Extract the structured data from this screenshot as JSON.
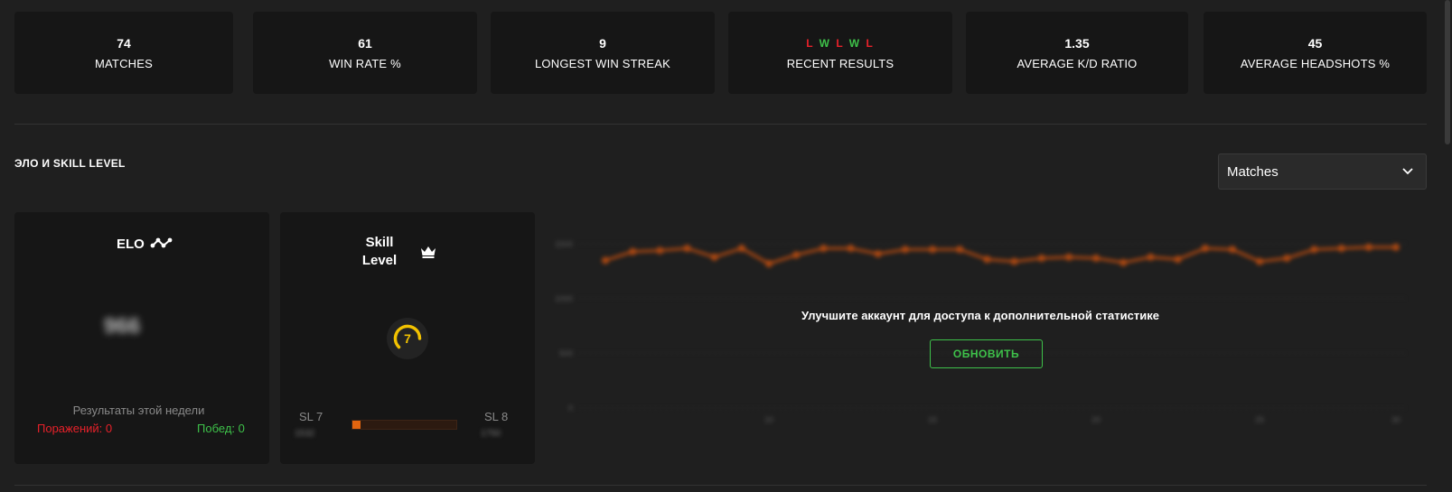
{
  "stats": [
    {
      "value": "74",
      "label": "MATCHES"
    },
    {
      "value": "61",
      "label": "WIN RATE %"
    },
    {
      "value": "9",
      "label": "LONGEST WIN STREAK"
    },
    {
      "value": "",
      "label": "RECENT RESULTS"
    },
    {
      "value": "1.35",
      "label": "AVERAGE K/D RATIO"
    },
    {
      "value": "45",
      "label": "AVERAGE HEADSHOTS %"
    }
  ],
  "recent_results": [
    "L",
    "W",
    "L",
    "W",
    "L"
  ],
  "section": {
    "title": "ЭЛО И SKILL LEVEL"
  },
  "select": {
    "value": "Matches"
  },
  "elo_card": {
    "title": "ELO",
    "value": "966",
    "week_title": "Результаты этой недели",
    "losses": "Поражений: 0",
    "wins": "Побед: 0"
  },
  "skill_card": {
    "title_line1": "Skill",
    "title_line2": "Level",
    "level": "7",
    "left_label": "SL 7",
    "right_label": "SL 8",
    "left_sub": "1532",
    "right_sub": "1750",
    "progress": 0.08
  },
  "chart_data": {
    "type": "line",
    "x": [
      1,
      2,
      3,
      4,
      5,
      6,
      7,
      8,
      9,
      10,
      11,
      12,
      13,
      14,
      15,
      16,
      17,
      18,
      19,
      20,
      21,
      22,
      23,
      24,
      25,
      26,
      27,
      28,
      29,
      30,
      31,
      32
    ],
    "y": [
      1350,
      1430,
      1440,
      1460,
      1380,
      1460,
      1320,
      1400,
      1460,
      1460,
      1410,
      1450,
      1450,
      1450,
      1360,
      1340,
      1370,
      1380,
      1370,
      1330,
      1380,
      1360,
      1460,
      1450,
      1340,
      1370,
      1450,
      1460,
      1470,
      1470
    ],
    "ytick_labels": [
      "1500",
      "1000",
      "500",
      "0"
    ],
    "xtick_labels": [
      "10",
      "15",
      "20",
      "25",
      "30"
    ],
    "color": "#c8500f",
    "blurred": true
  },
  "upgrade": {
    "text": "Улучшите аккаунт для доступа к дополнительной статистике",
    "button": "ОБНОВИТЬ"
  },
  "colors": {
    "win": "#3ec24a",
    "loss": "#e8212a",
    "accent": "#e4650f",
    "skill": "#f2c200"
  }
}
